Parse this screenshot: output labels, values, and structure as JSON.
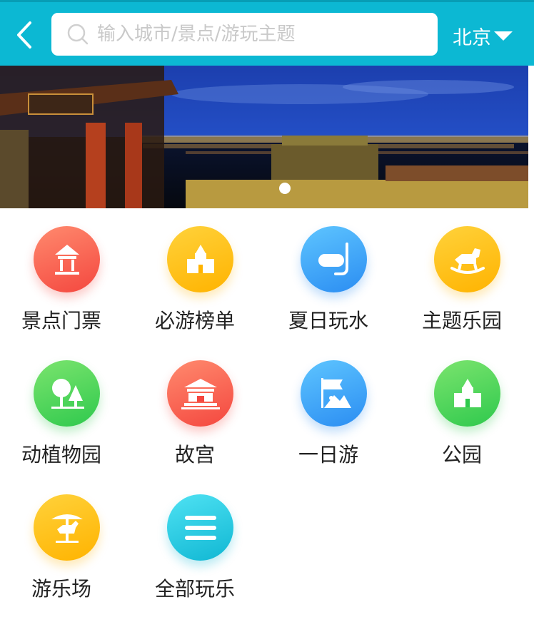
{
  "header": {
    "search_placeholder": "输入城市/景点/游玩主题",
    "city": "北京"
  },
  "banner": {
    "slide_count": 1,
    "active_slide": 1
  },
  "categories": [
    {
      "label": "景点门票",
      "icon": "pavilion-icon",
      "color": "#f4473f"
    },
    {
      "label": "必游榜单",
      "icon": "castle-icon",
      "color": "#ffb300"
    },
    {
      "label": "夏日玩水",
      "icon": "snorkel-mask-icon",
      "color": "#2b8df2"
    },
    {
      "label": "主题乐园",
      "icon": "rocking-horse-icon",
      "color": "#ffb300"
    },
    {
      "label": "动植物园",
      "icon": "trees-icon",
      "color": "#2fc94d"
    },
    {
      "label": "故宫",
      "icon": "palace-icon",
      "color": "#f4473f"
    },
    {
      "label": "一日游",
      "icon": "flag-mountain-icon",
      "color": "#2b8df2"
    },
    {
      "label": "公园",
      "icon": "park-castle-icon",
      "color": "#2fc94d"
    },
    {
      "label": "游乐场",
      "icon": "carousel-icon",
      "color": "#ffb300"
    },
    {
      "label": "全部玩乐",
      "icon": "menu-lines-icon",
      "color": "#10b7d3"
    }
  ]
}
